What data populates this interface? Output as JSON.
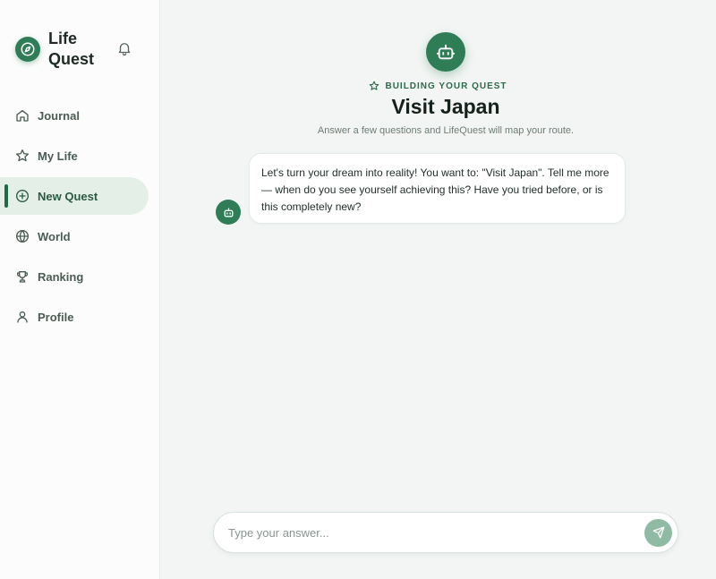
{
  "brand": {
    "name": "Life Quest"
  },
  "sidebar": {
    "items": [
      {
        "label": "Journal",
        "icon": "home-icon",
        "active": false
      },
      {
        "label": "My Life",
        "icon": "star-icon",
        "active": false
      },
      {
        "label": "New Quest",
        "icon": "plus-circle-icon",
        "active": true
      },
      {
        "label": "World",
        "icon": "globe-icon",
        "active": false
      },
      {
        "label": "Ranking",
        "icon": "trophy-icon",
        "active": false
      },
      {
        "label": "Profile",
        "icon": "user-icon",
        "active": false
      }
    ]
  },
  "header": {
    "eyebrow": "BUILDING YOUR QUEST",
    "title": "Visit Japan",
    "subtitle": "Answer a few questions and LifeQuest will map your route."
  },
  "chat": {
    "messages": [
      {
        "sender": "bot",
        "text": "Let's turn your dream into reality! You want to: \"Visit Japan\". Tell me more — when do you see yourself achieving this? Have you tried before, or is this completely new?"
      }
    ]
  },
  "composer": {
    "placeholder": "Type your answer...",
    "value": ""
  },
  "colors": {
    "accent": "#2f7d57",
    "active_bg": "#e4efe8",
    "background": "#f2f5f3"
  }
}
